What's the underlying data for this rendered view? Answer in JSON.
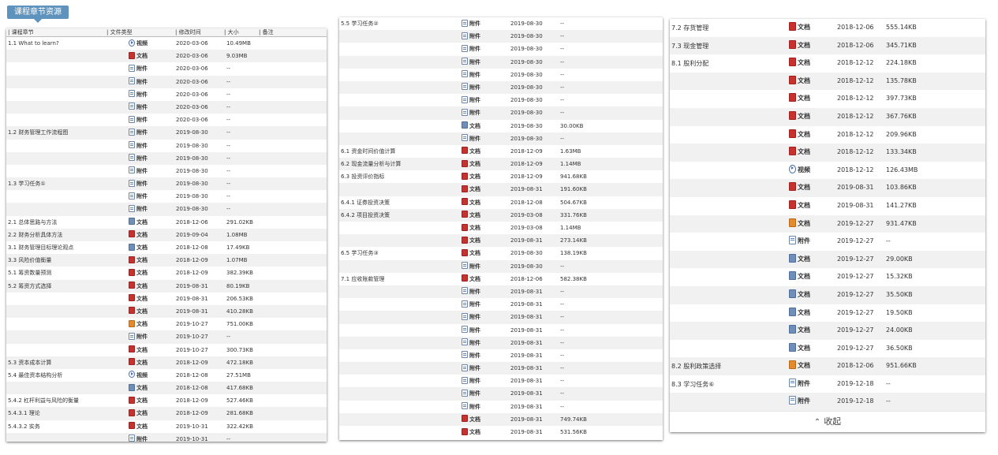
{
  "tag_label": "课程章节资源",
  "header": {
    "chapter": "| 课程章节",
    "type": "| 文件类型",
    "modified": "| 修改时间",
    "size": "| 大小",
    "note": "| 备注"
  },
  "collapse_label": "收起",
  "collapse_icon": "chevrons-up-icon",
  "panel1": [
    {
      "chapter": "1.1 What to learn?",
      "icon": "video",
      "type": "视频",
      "date": "2020-03-06",
      "size": "10.49MB"
    },
    {
      "chapter": "",
      "icon": "doc",
      "type": "文档",
      "date": "2020-03-06",
      "size": "9.03MB"
    },
    {
      "chapter": "",
      "icon": "att",
      "type": "附件",
      "date": "2020-03-06",
      "size": "--"
    },
    {
      "chapter": "",
      "icon": "att",
      "type": "附件",
      "date": "2020-03-06",
      "size": "--"
    },
    {
      "chapter": "",
      "icon": "att",
      "type": "附件",
      "date": "2020-03-06",
      "size": "--"
    },
    {
      "chapter": "",
      "icon": "att",
      "type": "附件",
      "date": "2020-03-06",
      "size": "--"
    },
    {
      "chapter": "",
      "icon": "att",
      "type": "附件",
      "date": "2020-03-06",
      "size": "--"
    },
    {
      "chapter": "1.2 财务管理工作流程图",
      "icon": "att",
      "type": "附件",
      "date": "2019-08-30",
      "size": "--"
    },
    {
      "chapter": "",
      "icon": "att",
      "type": "附件",
      "date": "2019-08-30",
      "size": "--"
    },
    {
      "chapter": "",
      "icon": "att",
      "type": "附件",
      "date": "2019-08-30",
      "size": "--"
    },
    {
      "chapter": "",
      "icon": "att",
      "type": "附件",
      "date": "2019-08-30",
      "size": "--"
    },
    {
      "chapter": "1.3 学习任务①",
      "icon": "att",
      "type": "附件",
      "date": "2019-08-30",
      "size": "--"
    },
    {
      "chapter": "",
      "icon": "att",
      "type": "附件",
      "date": "2019-08-30",
      "size": "--"
    },
    {
      "chapter": "",
      "icon": "att",
      "type": "附件",
      "date": "2019-08-30",
      "size": "--"
    },
    {
      "chapter": "2.1 总体思路与方法",
      "icon": "img",
      "type": "文档",
      "date": "2018-12-06",
      "size": "291.02KB"
    },
    {
      "chapter": "2.2 财务分析具体方法",
      "icon": "doc",
      "type": "文档",
      "date": "2019-09-04",
      "size": "1.08MB"
    },
    {
      "chapter": "3.1 财务管理目标理论观点",
      "icon": "img",
      "type": "文档",
      "date": "2018-12-08",
      "size": "17.49KB"
    },
    {
      "chapter": "3.3 风险价值衡量",
      "icon": "doc",
      "type": "文档",
      "date": "2018-12-09",
      "size": "1.07MB"
    },
    {
      "chapter": "5.1 筹资数量预测",
      "icon": "doc",
      "type": "文档",
      "date": "2018-12-09",
      "size": "382.39KB"
    },
    {
      "chapter": "5.2 筹资方式选择",
      "icon": "doc",
      "type": "文档",
      "date": "2019-08-31",
      "size": "80.19KB"
    },
    {
      "chapter": "",
      "icon": "doc",
      "type": "文档",
      "date": "2019-08-31",
      "size": "206.53KB"
    },
    {
      "chapter": "",
      "icon": "doc",
      "type": "文档",
      "date": "2019-08-31",
      "size": "410.28KB"
    },
    {
      "chapter": "",
      "icon": "xls",
      "type": "文档",
      "date": "2019-10-27",
      "size": "751.00KB"
    },
    {
      "chapter": "",
      "icon": "att",
      "type": "附件",
      "date": "2019-10-27",
      "size": "--"
    },
    {
      "chapter": "",
      "icon": "doc",
      "type": "文档",
      "date": "2019-10-27",
      "size": "300.73KB"
    },
    {
      "chapter": "5.3 资本成本计算",
      "icon": "doc",
      "type": "文档",
      "date": "2018-12-09",
      "size": "472.18KB"
    },
    {
      "chapter": "5.4 最佳资本结构分析",
      "icon": "video",
      "type": "视频",
      "date": "2018-12-08",
      "size": "27.51MB"
    },
    {
      "chapter": "",
      "icon": "img",
      "type": "文档",
      "date": "2018-12-08",
      "size": "417.68KB"
    },
    {
      "chapter": "5.4.2 杠杆利益与风险的衡量",
      "icon": "doc",
      "type": "文档",
      "date": "2018-12-09",
      "size": "527.46KB"
    },
    {
      "chapter": "5.4.3.1 理论",
      "icon": "doc",
      "type": "文档",
      "date": "2018-12-09",
      "size": "281.68KB"
    },
    {
      "chapter": "5.4.3.2 实务",
      "icon": "doc",
      "type": "文档",
      "date": "2019-10-31",
      "size": "322.42KB"
    },
    {
      "chapter": "",
      "icon": "att",
      "type": "附件",
      "date": "2019-10-31",
      "size": "--"
    }
  ],
  "panel2": [
    {
      "chapter": "5.5 学习任务②",
      "icon": "att",
      "type": "附件",
      "date": "2019-08-30",
      "size": "--"
    },
    {
      "chapter": "",
      "icon": "att",
      "type": "附件",
      "date": "2019-08-30",
      "size": "--"
    },
    {
      "chapter": "",
      "icon": "att",
      "type": "附件",
      "date": "2019-08-30",
      "size": "--"
    },
    {
      "chapter": "",
      "icon": "att",
      "type": "附件",
      "date": "2019-08-30",
      "size": "--"
    },
    {
      "chapter": "",
      "icon": "att",
      "type": "附件",
      "date": "2019-08-30",
      "size": "--"
    },
    {
      "chapter": "",
      "icon": "att",
      "type": "附件",
      "date": "2019-08-30",
      "size": "--"
    },
    {
      "chapter": "",
      "icon": "att",
      "type": "附件",
      "date": "2019-08-30",
      "size": "--"
    },
    {
      "chapter": "",
      "icon": "att",
      "type": "附件",
      "date": "2019-08-30",
      "size": "--"
    },
    {
      "chapter": "",
      "icon": "img",
      "type": "文档",
      "date": "2019-08-30",
      "size": "30.00KB"
    },
    {
      "chapter": "",
      "icon": "att",
      "type": "附件",
      "date": "2019-08-30",
      "size": "--"
    },
    {
      "chapter": "6.1 资金时间价值计算",
      "icon": "doc",
      "type": "文档",
      "date": "2018-12-09",
      "size": "1.63MB"
    },
    {
      "chapter": "6.2 现金流量分析与计算",
      "icon": "doc",
      "type": "文档",
      "date": "2018-12-09",
      "size": "1.14MB"
    },
    {
      "chapter": "6.3 投资评价指标",
      "icon": "doc",
      "type": "文档",
      "date": "2018-12-09",
      "size": "941.68KB"
    },
    {
      "chapter": "",
      "icon": "doc",
      "type": "文档",
      "date": "2019-08-31",
      "size": "191.60KB"
    },
    {
      "chapter": "6.4.1 证券投资决策",
      "icon": "doc",
      "type": "文档",
      "date": "2018-12-08",
      "size": "504.67KB"
    },
    {
      "chapter": "6.4.2 项目投资决策",
      "icon": "doc",
      "type": "文档",
      "date": "2019-03-08",
      "size": "331.76KB"
    },
    {
      "chapter": "",
      "icon": "doc",
      "type": "文档",
      "date": "2019-03-08",
      "size": "1.14MB"
    },
    {
      "chapter": "",
      "icon": "doc",
      "type": "文档",
      "date": "2019-08-31",
      "size": "273.14KB"
    },
    {
      "chapter": "6.5 学习任务③",
      "icon": "doc",
      "type": "文档",
      "date": "2019-08-30",
      "size": "138.19KB"
    },
    {
      "chapter": "",
      "icon": "att",
      "type": "附件",
      "date": "2019-08-30",
      "size": "--"
    },
    {
      "chapter": "7.1 应收账款管理",
      "icon": "doc",
      "type": "文档",
      "date": "2018-12-06",
      "size": "582.38KB"
    },
    {
      "chapter": "",
      "icon": "att",
      "type": "附件",
      "date": "2019-08-31",
      "size": "--"
    },
    {
      "chapter": "",
      "icon": "att",
      "type": "附件",
      "date": "2019-08-31",
      "size": "--"
    },
    {
      "chapter": "",
      "icon": "att",
      "type": "附件",
      "date": "2019-08-31",
      "size": "--"
    },
    {
      "chapter": "",
      "icon": "att",
      "type": "附件",
      "date": "2019-08-31",
      "size": "--"
    },
    {
      "chapter": "",
      "icon": "att",
      "type": "附件",
      "date": "2019-08-31",
      "size": "--"
    },
    {
      "chapter": "",
      "icon": "att",
      "type": "附件",
      "date": "2019-08-31",
      "size": "--"
    },
    {
      "chapter": "",
      "icon": "att",
      "type": "附件",
      "date": "2019-08-31",
      "size": "--"
    },
    {
      "chapter": "",
      "icon": "att",
      "type": "附件",
      "date": "2019-08-31",
      "size": "--"
    },
    {
      "chapter": "",
      "icon": "att",
      "type": "附件",
      "date": "2019-08-31",
      "size": "--"
    },
    {
      "chapter": "",
      "icon": "att",
      "type": "附件",
      "date": "2019-08-31",
      "size": "--"
    },
    {
      "chapter": "",
      "icon": "doc",
      "type": "文档",
      "date": "2019-08-31",
      "size": "749.74KB"
    },
    {
      "chapter": "",
      "icon": "doc",
      "type": "文档",
      "date": "2019-08-31",
      "size": "531.56KB"
    }
  ],
  "panel3": [
    {
      "chapter": "7.2 存货管理",
      "icon": "doc",
      "type": "文档",
      "date": "2018-12-06",
      "size": "555.14KB"
    },
    {
      "chapter": "7.3 现金管理",
      "icon": "doc",
      "type": "文档",
      "date": "2018-12-06",
      "size": "345.71KB"
    },
    {
      "chapter": "8.1 股利分配",
      "icon": "doc",
      "type": "文档",
      "date": "2018-12-12",
      "size": "224.18KB"
    },
    {
      "chapter": "",
      "icon": "doc",
      "type": "文档",
      "date": "2018-12-12",
      "size": "135.78KB"
    },
    {
      "chapter": "",
      "icon": "doc",
      "type": "文档",
      "date": "2018-12-12",
      "size": "397.73KB"
    },
    {
      "chapter": "",
      "icon": "doc",
      "type": "文档",
      "date": "2018-12-12",
      "size": "367.76KB"
    },
    {
      "chapter": "",
      "icon": "doc",
      "type": "文档",
      "date": "2018-12-12",
      "size": "209.96KB"
    },
    {
      "chapter": "",
      "icon": "doc",
      "type": "文档",
      "date": "2018-12-12",
      "size": "133.34KB"
    },
    {
      "chapter": "",
      "icon": "video",
      "type": "视频",
      "date": "2018-12-12",
      "size": "126.43MB"
    },
    {
      "chapter": "",
      "icon": "doc",
      "type": "文档",
      "date": "2019-08-31",
      "size": "103.86KB"
    },
    {
      "chapter": "",
      "icon": "doc",
      "type": "文档",
      "date": "2019-08-31",
      "size": "141.27KB"
    },
    {
      "chapter": "",
      "icon": "xls",
      "type": "文档",
      "date": "2019-12-27",
      "size": "931.47KB"
    },
    {
      "chapter": "",
      "icon": "att",
      "type": "附件",
      "date": "2019-12-27",
      "size": "--"
    },
    {
      "chapter": "",
      "icon": "img",
      "type": "文档",
      "date": "2019-12-27",
      "size": "29.00KB"
    },
    {
      "chapter": "",
      "icon": "img",
      "type": "文档",
      "date": "2019-12-27",
      "size": "15.32KB"
    },
    {
      "chapter": "",
      "icon": "img",
      "type": "文档",
      "date": "2019-12-27",
      "size": "35.50KB"
    },
    {
      "chapter": "",
      "icon": "img",
      "type": "文档",
      "date": "2019-12-27",
      "size": "19.50KB"
    },
    {
      "chapter": "",
      "icon": "img",
      "type": "文档",
      "date": "2019-12-27",
      "size": "24.00KB"
    },
    {
      "chapter": "",
      "icon": "img",
      "type": "文档",
      "date": "2019-12-27",
      "size": "36.50KB"
    },
    {
      "chapter": "8.2 股利政策选择",
      "icon": "xls",
      "type": "文档",
      "date": "2018-12-06",
      "size": "951.66KB"
    },
    {
      "chapter": "8.3 学习任务⑥",
      "icon": "att",
      "type": "附件",
      "date": "2019-12-18",
      "size": "--"
    },
    {
      "chapter": "",
      "icon": "att",
      "type": "附件",
      "date": "2019-12-18",
      "size": "--"
    }
  ]
}
